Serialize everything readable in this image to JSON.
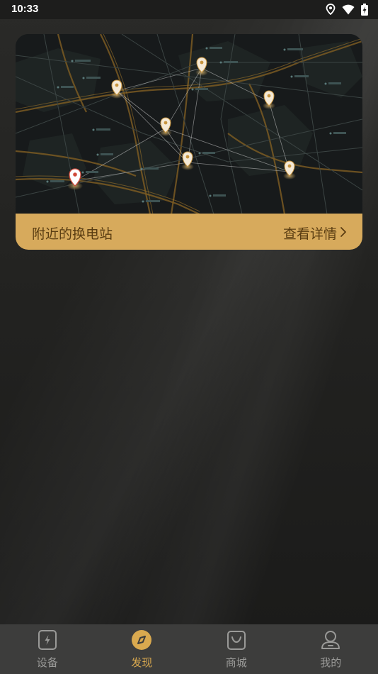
{
  "status_bar": {
    "time": "10:33"
  },
  "map_card": {
    "title": "附近的换电站",
    "details_link": "查看详情",
    "arrow": ">"
  },
  "bottom_nav": {
    "items": [
      {
        "label": "设备",
        "icon": "device-icon",
        "active": false
      },
      {
        "label": "发现",
        "icon": "compass-icon",
        "active": true
      },
      {
        "label": "商城",
        "icon": "shopping-bag-icon",
        "active": false
      },
      {
        "label": "我的",
        "icon": "user-icon",
        "active": false
      }
    ]
  },
  "colors": {
    "accent": "#d7aa5c",
    "nav_active": "#d9a94f",
    "nav_inactive": "#9a9a98",
    "nav_background": "#3d3d3c"
  }
}
